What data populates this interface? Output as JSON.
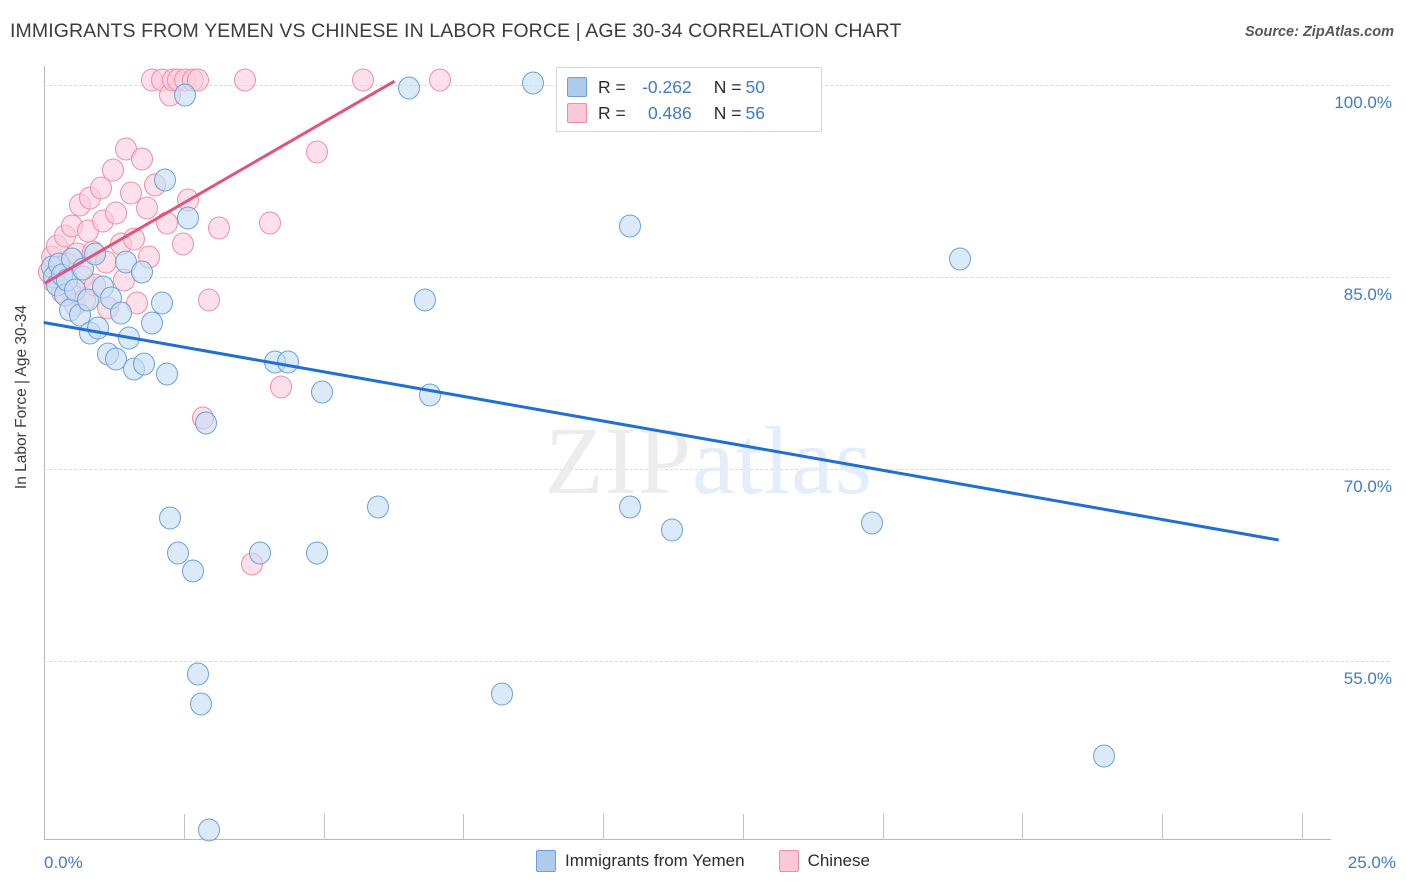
{
  "header": {
    "title": "IMMIGRANTS FROM YEMEN VS CHINESE IN LABOR FORCE | AGE 30-34 CORRELATION CHART",
    "source": "Source: ZipAtlas.com"
  },
  "watermark": {
    "part1": "ZIP",
    "part2": "atlas"
  },
  "stats": {
    "rows": [
      {
        "color": "blue",
        "r_label": "R =",
        "r_value": "-0.262",
        "n_label": "N =",
        "n_value": "50"
      },
      {
        "color": "pink",
        "r_label": "R =",
        "r_value": "0.486",
        "n_label": "N =",
        "n_value": "56"
      }
    ]
  },
  "colors": {
    "blue_fill": "#c5ddf6",
    "blue_stroke": "#6d9fd8",
    "pink_fill": "#fccddb",
    "pink_stroke": "#ef8ca9",
    "blue_line": "#1f6fd4",
    "pink_line": "#e3537f",
    "axis_label": "#3d7cc9",
    "grid": "#dadada"
  },
  "chart_data": {
    "type": "scatter",
    "title": "IMMIGRANTS FROM YEMEN VS CHINESE IN LABOR FORCE | AGE 30-34 CORRELATION CHART",
    "xlabel": "",
    "ylabel": "In Labor Force | Age 30-34",
    "xlim": [
      0.0,
      25.0
    ],
    "ylim": [
      41.0,
      101.5
    ],
    "x_tick_labels": [
      "0.0%",
      "25.0%"
    ],
    "y_tick_labels": [
      "100.0%",
      "85.0%",
      "70.0%",
      "55.0%"
    ],
    "y_ticks": [
      100.0,
      85.0,
      70.0,
      55.0
    ],
    "grid": true,
    "legend_position": "bottom-center",
    "series": [
      {
        "name": "Immigrants from Yemen",
        "color": "#c5ddf6",
        "R": -0.262,
        "N": 50,
        "trendline": {
          "x0": 0.0,
          "y0": 81.6,
          "x1": 24.0,
          "y1": 64.6
        },
        "points": [
          [
            0.15,
            85.8
          ],
          [
            0.2,
            85.0
          ],
          [
            0.25,
            84.4
          ],
          [
            0.3,
            86.0
          ],
          [
            0.35,
            85.2
          ],
          [
            0.4,
            83.6
          ],
          [
            0.45,
            84.8
          ],
          [
            0.5,
            82.4
          ],
          [
            0.55,
            86.4
          ],
          [
            0.6,
            84.0
          ],
          [
            0.7,
            82.0
          ],
          [
            0.75,
            85.6
          ],
          [
            0.85,
            83.2
          ],
          [
            0.9,
            80.6
          ],
          [
            1.0,
            86.8
          ],
          [
            1.05,
            81.0
          ],
          [
            1.15,
            84.2
          ],
          [
            1.25,
            79.0
          ],
          [
            1.3,
            83.4
          ],
          [
            1.4,
            78.6
          ],
          [
            1.5,
            82.2
          ],
          [
            1.6,
            86.2
          ],
          [
            1.65,
            80.2
          ],
          [
            1.75,
            77.8
          ],
          [
            1.9,
            85.4
          ],
          [
            1.95,
            78.2
          ],
          [
            2.1,
            81.4
          ],
          [
            2.3,
            83.0
          ],
          [
            2.35,
            92.6
          ],
          [
            2.4,
            77.4
          ],
          [
            2.45,
            66.2
          ],
          [
            2.6,
            63.4
          ],
          [
            2.75,
            99.2
          ],
          [
            2.8,
            89.6
          ],
          [
            2.9,
            62.0
          ],
          [
            3.0,
            54.0
          ],
          [
            3.05,
            51.6
          ],
          [
            3.15,
            73.6
          ],
          [
            3.2,
            41.8
          ],
          [
            4.2,
            63.4
          ],
          [
            4.5,
            78.4
          ],
          [
            4.75,
            78.4
          ],
          [
            5.3,
            63.4
          ],
          [
            5.4,
            76.0
          ],
          [
            6.5,
            67.0
          ],
          [
            7.1,
            99.8
          ],
          [
            7.4,
            83.2
          ],
          [
            7.5,
            75.8
          ],
          [
            8.9,
            52.4
          ],
          [
            9.5,
            100.2
          ],
          [
            11.4,
            89.0
          ],
          [
            11.4,
            67.0
          ],
          [
            12.2,
            65.2
          ],
          [
            16.1,
            65.8
          ],
          [
            17.8,
            86.4
          ],
          [
            20.6,
            47.6
          ]
        ]
      },
      {
        "name": "Chinese",
        "color": "#fccddb",
        "R": 0.486,
        "N": 56,
        "trendline": {
          "x0": 0.0,
          "y0": 84.6,
          "x1": 6.8,
          "y1": 100.4
        },
        "points": [
          [
            0.1,
            85.4
          ],
          [
            0.15,
            86.6
          ],
          [
            0.2,
            84.6
          ],
          [
            0.25,
            87.4
          ],
          [
            0.3,
            85.8
          ],
          [
            0.35,
            83.8
          ],
          [
            0.4,
            88.2
          ],
          [
            0.45,
            86.0
          ],
          [
            0.5,
            84.0
          ],
          [
            0.55,
            89.0
          ],
          [
            0.6,
            82.8
          ],
          [
            0.65,
            86.8
          ],
          [
            0.7,
            90.6
          ],
          [
            0.75,
            85.0
          ],
          [
            0.8,
            83.2
          ],
          [
            0.85,
            88.6
          ],
          [
            0.9,
            91.2
          ],
          [
            0.95,
            87.0
          ],
          [
            1.0,
            84.4
          ],
          [
            1.1,
            92.0
          ],
          [
            1.15,
            89.4
          ],
          [
            1.2,
            86.2
          ],
          [
            1.25,
            82.6
          ],
          [
            1.35,
            93.4
          ],
          [
            1.4,
            90.0
          ],
          [
            1.5,
            87.6
          ],
          [
            1.55,
            84.8
          ],
          [
            1.6,
            95.0
          ],
          [
            1.7,
            91.6
          ],
          [
            1.75,
            88.0
          ],
          [
            1.8,
            83.0
          ],
          [
            1.9,
            94.2
          ],
          [
            2.0,
            90.4
          ],
          [
            2.05,
            86.6
          ],
          [
            2.1,
            100.4
          ],
          [
            2.15,
            92.2
          ],
          [
            2.3,
            100.4
          ],
          [
            2.4,
            89.2
          ],
          [
            2.45,
            99.2
          ],
          [
            2.5,
            100.4
          ],
          [
            2.6,
            100.4
          ],
          [
            2.7,
            87.6
          ],
          [
            2.75,
            100.4
          ],
          [
            2.8,
            91.0
          ],
          [
            2.9,
            100.4
          ],
          [
            3.0,
            100.4
          ],
          [
            3.1,
            74.0
          ],
          [
            3.2,
            83.2
          ],
          [
            3.4,
            88.8
          ],
          [
            3.9,
            100.4
          ],
          [
            4.05,
            62.6
          ],
          [
            4.4,
            89.2
          ],
          [
            4.6,
            76.4
          ],
          [
            5.3,
            94.8
          ],
          [
            6.2,
            100.4
          ],
          [
            7.7,
            100.4
          ]
        ]
      }
    ]
  }
}
